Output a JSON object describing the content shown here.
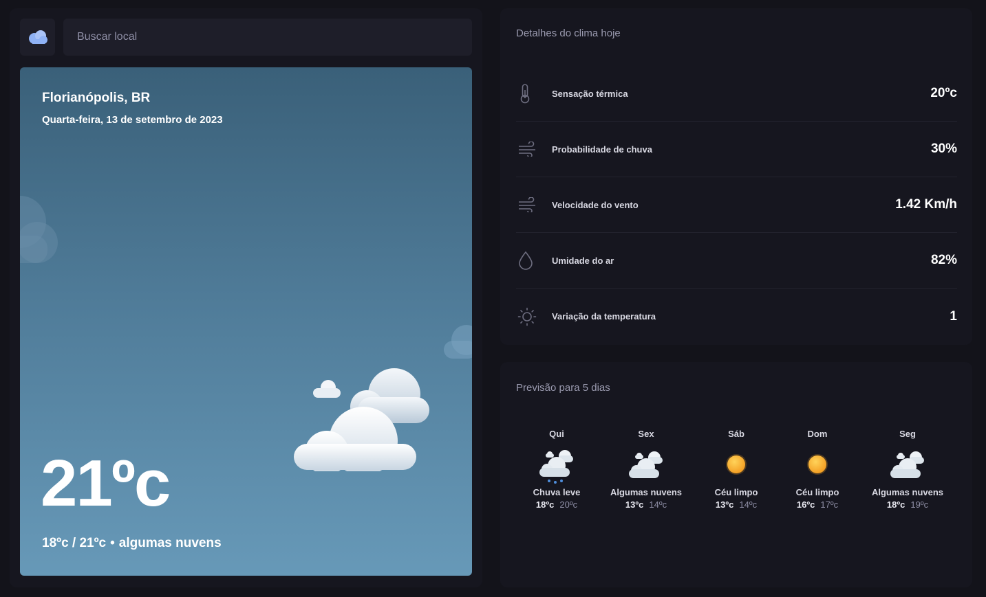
{
  "search": {
    "placeholder": "Buscar local"
  },
  "current": {
    "city": "Florianópolis, BR",
    "date": "Quarta-feira, 13 de setembro de 2023",
    "temp": "21ºc",
    "range": "18ºc / 21ºc",
    "separator": "•",
    "description": "algumas nuvens"
  },
  "details": {
    "title": "Detalhes do clima hoje",
    "items": [
      {
        "icon": "thermometer-icon",
        "label": "Sensação térmica",
        "value": "20ºc"
      },
      {
        "icon": "wind-icon",
        "label": "Probabilidade de chuva",
        "value": "30%"
      },
      {
        "icon": "wind-icon",
        "label": "Velocidade do vento",
        "value": "1.42 Km/h"
      },
      {
        "icon": "drop-icon",
        "label": "Umidade do ar",
        "value": "82%"
      },
      {
        "icon": "sun-icon",
        "label": "Variação da temperatura",
        "value": "1"
      }
    ]
  },
  "forecast": {
    "title": "Previsão para 5 dias",
    "days": [
      {
        "day": "Qui",
        "icon": "rain-cloud-icon",
        "condition": "Chuva leve",
        "min": "18ºc",
        "max": "20ºc"
      },
      {
        "day": "Sex",
        "icon": "cloud-icon",
        "condition": "Algumas nuvens",
        "min": "13ºc",
        "max": "14ºc"
      },
      {
        "day": "Sáb",
        "icon": "sun-icon",
        "condition": "Céu limpo",
        "min": "13ºc",
        "max": "14ºc"
      },
      {
        "day": "Dom",
        "icon": "sun-icon",
        "condition": "Céu limpo",
        "min": "16ºc",
        "max": "17ºc"
      },
      {
        "day": "Seg",
        "icon": "cloud-icon",
        "condition": "Algumas nuvens",
        "min": "18ºc",
        "max": "19ºc"
      }
    ]
  },
  "colors": {
    "background": "#13131a",
    "panel": "#16161f",
    "accent": "#8fb2f5",
    "sun": "#f7a823"
  }
}
